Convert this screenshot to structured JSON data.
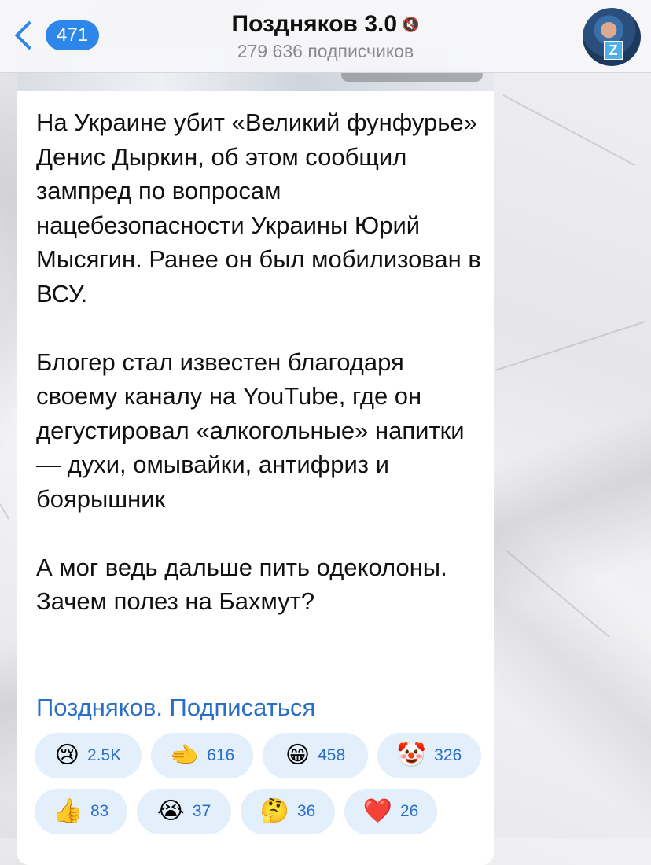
{
  "header": {
    "back_count": "471",
    "title": "Поздняков 3.0",
    "subtitle": "279 636 подписчиков"
  },
  "message": {
    "text": "На Украине убит «Великий фунфурье» Денис Дыркин, об этом сообщил зампред по вопросам нацебезопасности Украины Юрий Мысягин. Ранее он был мобилизован в ВСУ.\n\nБлогер стал известен благодаря своему каналу на YouTube, где он дегустировал «алкогольные» напитки — духи, омывайки, антифриз и боярышник\n\nА мог ведь дальше пить одеколоны. Зачем полез на Бахмут?",
    "link": "Поздняков. Подписаться"
  },
  "reactions": [
    {
      "emoji": "😢",
      "count": "2.5K"
    },
    {
      "emoji": "🫲",
      "count": "616"
    },
    {
      "emoji": "😁",
      "count": "458"
    },
    {
      "emoji": "🤡",
      "count": "326"
    },
    {
      "emoji": "👍",
      "count": "83"
    },
    {
      "emoji": "😭",
      "count": "37"
    },
    {
      "emoji": "🤔",
      "count": "36"
    },
    {
      "emoji": "❤️",
      "count": "26"
    }
  ],
  "icons": {
    "back": "chevron-left-icon",
    "mute": "muted-speaker-icon",
    "avatar": "channel-avatar"
  }
}
